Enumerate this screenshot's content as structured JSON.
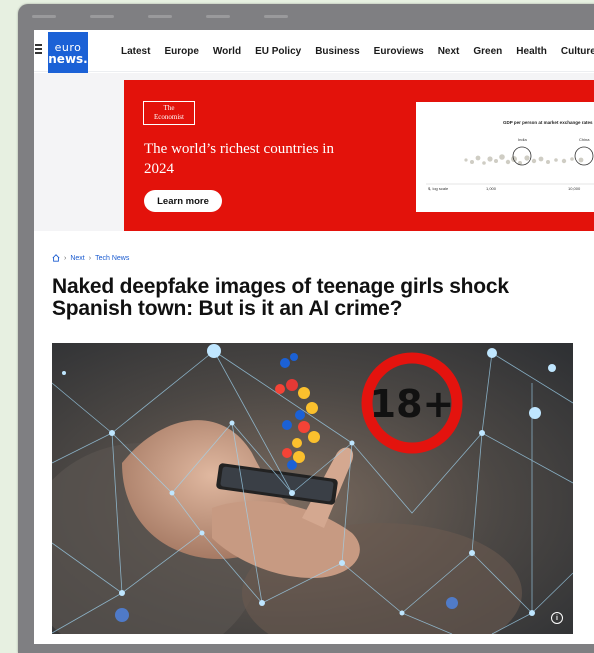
{
  "logo": {
    "line1": "euro",
    "line2": "news."
  },
  "nav": [
    "Latest",
    "Europe",
    "World",
    "EU Policy",
    "Business",
    "Euroviews",
    "Next",
    "Green",
    "Health",
    "Culture"
  ],
  "ad": {
    "brand_line1": "The",
    "brand_line2": "Economist",
    "title": "The world’s richest countries in 2024",
    "button": "Learn more",
    "chart_title": "GDP per person at market exchange rates",
    "chart_labels": {
      "india": "India",
      "china": "China",
      "axis_note": "$, log scale",
      "tick1": "1,000",
      "tick2": "10,000"
    }
  },
  "breadcrumb": {
    "level1": "Next",
    "level2": "Tech News"
  },
  "article": {
    "headline": "Naked deepfake images of teenage girls shock Spanish town: But is it an AI crime?",
    "badge": "18+"
  },
  "colors": {
    "brand_blue": "#1b61d6",
    "economist_red": "#e3120b",
    "badge_red": "#e4130e"
  },
  "icons": [
    "menu-icon",
    "home-icon",
    "chevron-right-icon",
    "info-icon",
    "like-icon",
    "heart-icon",
    "emoji-icon"
  ]
}
